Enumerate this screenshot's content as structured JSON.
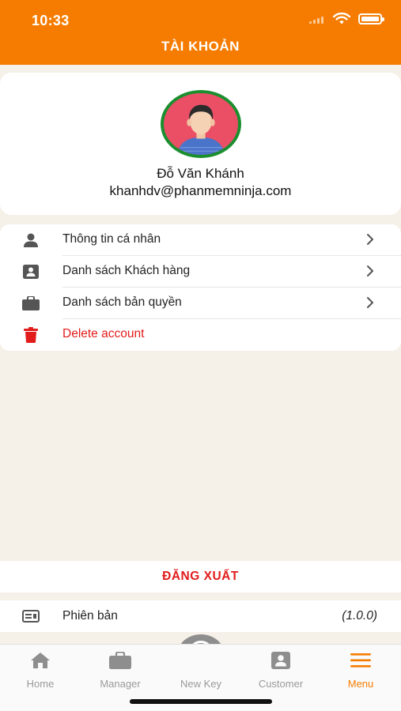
{
  "status_bar": {
    "time": "10:33"
  },
  "header": {
    "title": "TÀI KHOẢN"
  },
  "profile": {
    "name": "Đỗ Văn Khánh",
    "email": "khanhdv@phanmemninja.com"
  },
  "menu": {
    "items": [
      {
        "label": "Thông tin cá nhân",
        "icon": "person-icon"
      },
      {
        "label": "Danh sách Khách hàng",
        "icon": "contact-card-icon"
      },
      {
        "label": "Danh sách bản quyền",
        "icon": "briefcase-icon"
      },
      {
        "label": "Delete account",
        "icon": "trash-icon"
      }
    ]
  },
  "logout": {
    "label": "ĐĂNG XUẤT"
  },
  "version": {
    "label": "Phiên bản",
    "value": "(1.0.0)",
    "icon": "device-icon"
  },
  "tabbar": {
    "tabs": [
      {
        "label": "Home",
        "icon": "home-icon"
      },
      {
        "label": "Manager",
        "icon": "briefcase-icon"
      },
      {
        "label": "New Key",
        "icon": "plus-circle-icon"
      },
      {
        "label": "Customer",
        "icon": "contact-card-icon"
      },
      {
        "label": "Menu",
        "icon": "hamburger-icon"
      }
    ],
    "active": "Menu"
  },
  "colors": {
    "accent": "#f57c00",
    "danger": "#e21b1b",
    "background": "#f5f0e8",
    "avatar_ring": "#1a8f2e"
  }
}
